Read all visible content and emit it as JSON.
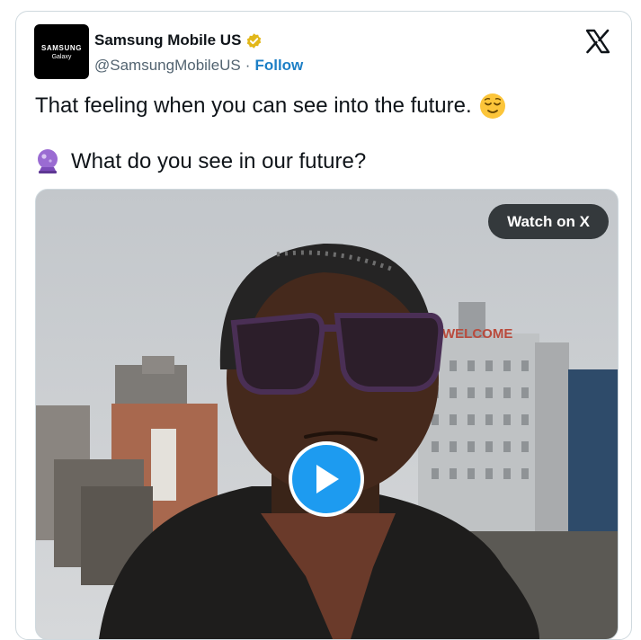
{
  "account": {
    "avatar_line1": "SAMSUNG",
    "avatar_line2": "Galaxy",
    "display_name": "Samsung Mobile US",
    "handle": "@SamsungMobileUS",
    "separator": "·",
    "follow_label": "Follow",
    "verified_color": "#e2b719"
  },
  "tweet": {
    "line1": "That feeling when you can see into the future.",
    "line2": "What do you see in our future?",
    "emoji1": "relieved-face",
    "emoji2": "crystal-ball"
  },
  "media": {
    "watch_label": "Watch on X",
    "sign_text": "WELCOME"
  },
  "colors": {
    "accent_blue": "#1d9bf0",
    "follow_blue": "#1d7fc6",
    "text": "#0f1419",
    "muted": "#536471"
  }
}
